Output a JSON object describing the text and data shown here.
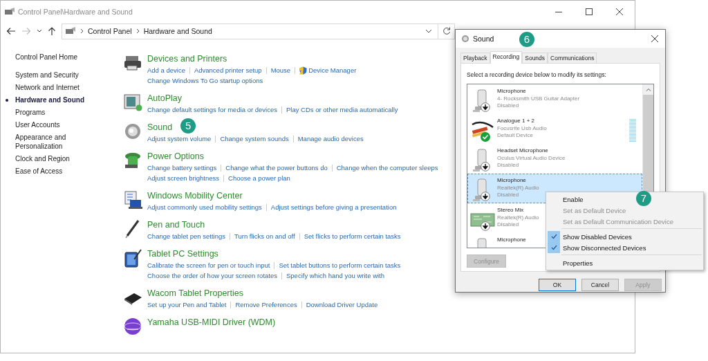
{
  "window": {
    "title": "Control Panel\\Hardware and Sound"
  },
  "address": {
    "crumbs": [
      "Control Panel",
      "Hardware and Sound"
    ]
  },
  "sidebar": {
    "home": "Control Panel Home",
    "items": [
      {
        "label": "System and Security",
        "selected": false
      },
      {
        "label": "Network and Internet",
        "selected": false
      },
      {
        "label": "Hardware and Sound",
        "selected": true
      },
      {
        "label": "Programs",
        "selected": false
      },
      {
        "label": "User Accounts",
        "selected": false
      },
      {
        "label": "Appearance and Personalization",
        "selected": false
      },
      {
        "label": "Clock and Region",
        "selected": false
      },
      {
        "label": "Ease of Access",
        "selected": false
      }
    ]
  },
  "categories": [
    {
      "kind": "printer",
      "title": "Devices and Printers",
      "lines": [
        [
          {
            "text": "Add a device",
            "shield": false
          },
          {
            "text": "Advanced printer setup",
            "shield": false
          },
          {
            "text": "Mouse",
            "shield": false
          },
          {
            "text": "Device Manager",
            "shield": true
          }
        ],
        [
          {
            "text": "Change Windows To Go startup options",
            "shield": false
          }
        ]
      ]
    },
    {
      "kind": "autoplay",
      "title": "AutoPlay",
      "lines": [
        [
          {
            "text": "Change default settings for media or devices",
            "shield": false
          },
          {
            "text": "Play CDs or other media automatically",
            "shield": false
          }
        ]
      ]
    },
    {
      "kind": "sound",
      "title": "Sound",
      "callout": "5",
      "lines": [
        [
          {
            "text": "Adjust system volume",
            "shield": false
          },
          {
            "text": "Change system sounds",
            "shield": false
          },
          {
            "text": "Manage audio devices",
            "shield": false
          }
        ]
      ]
    },
    {
      "kind": "power",
      "title": "Power Options",
      "lines": [
        [
          {
            "text": "Change battery settings",
            "shield": false
          },
          {
            "text": "Change what the power buttons do",
            "shield": false
          },
          {
            "text": "Change when the computer sleeps",
            "shield": false
          }
        ],
        [
          {
            "text": "Adjust screen brightness",
            "shield": false
          },
          {
            "text": "Choose a power plan",
            "shield": false
          }
        ]
      ]
    },
    {
      "kind": "mobility",
      "title": "Windows Mobility Center",
      "lines": [
        [
          {
            "text": "Adjust commonly used mobility settings",
            "shield": false
          },
          {
            "text": "Adjust settings before giving a presentation",
            "shield": false
          }
        ]
      ]
    },
    {
      "kind": "pen",
      "title": "Pen and Touch",
      "lines": [
        [
          {
            "text": "Change tablet pen settings",
            "shield": false
          },
          {
            "text": "Turn flicks on and off",
            "shield": false
          },
          {
            "text": "Set flicks to perform certain tasks",
            "shield": false
          }
        ]
      ]
    },
    {
      "kind": "tablet",
      "title": "Tablet PC Settings",
      "lines": [
        [
          {
            "text": "Calibrate the screen for pen or touch input",
            "shield": false
          },
          {
            "text": "Set tablet buttons to perform certain tasks",
            "shield": false
          }
        ],
        [
          {
            "text": "Choose the order of how your screen rotates",
            "shield": false
          },
          {
            "text": "Specify which hand you write with",
            "shield": false
          }
        ]
      ]
    },
    {
      "kind": "wacom",
      "title": "Wacom Tablet Properties",
      "lines": [
        [
          {
            "text": "Set up your Pen and Tablet",
            "shield": false
          },
          {
            "text": "Remove Preferences",
            "shield": false
          },
          {
            "text": "Download Driver Update",
            "shield": false
          }
        ]
      ]
    },
    {
      "kind": "midi",
      "title": "Yamaha USB-MIDI Driver (WDM)"
    }
  ],
  "dialog": {
    "title": "Sound",
    "callout": "6",
    "tabs": [
      {
        "label": "Playback",
        "selected": false
      },
      {
        "label": "Recording",
        "selected": true
      },
      {
        "label": "Sounds",
        "selected": false
      },
      {
        "label": "Communications",
        "selected": false
      }
    ],
    "instruction": "Select a recording device below to modify its settings:",
    "devices": [
      {
        "kind": "mic",
        "name": "Microphone",
        "lines": [
          "4- Rocksmith USB Guitar Adapter",
          "Disabled"
        ],
        "disabled": true,
        "default": false,
        "selected": false,
        "meter": false
      },
      {
        "kind": "cable",
        "name": "Analogue 1 + 2",
        "lines": [
          "Focusrite Usb Audio",
          "Default Device"
        ],
        "disabled": false,
        "default": true,
        "selected": false,
        "meter": true
      },
      {
        "kind": "mic",
        "name": "Headset Microphone",
        "lines": [
          "Oculus Virtual Audio Device",
          "Disabled"
        ],
        "disabled": true,
        "default": false,
        "selected": false,
        "meter": false
      },
      {
        "kind": "mic",
        "name": "Microphone",
        "lines": [
          "Realtek(R) Audio",
          "Disabled"
        ],
        "disabled": true,
        "default": false,
        "selected": true,
        "meter": false
      },
      {
        "kind": "board",
        "name": "Stereo Mix",
        "lines": [
          "Realtek(R) Audio",
          "Disabled"
        ],
        "disabled": true,
        "default": false,
        "selected": false,
        "meter": false
      },
      {
        "kind": "mic",
        "name": "Microphone",
        "disabled": false,
        "default": false,
        "selected": false,
        "meter": false
      }
    ],
    "configure": {
      "label": "Configure",
      "disabled": true
    },
    "buttons": [
      {
        "label": "OK",
        "disabled": false,
        "default": true
      },
      {
        "label": "Cancel",
        "disabled": false,
        "default": false
      },
      {
        "label": "Apply",
        "disabled": true,
        "default": false
      }
    ]
  },
  "context_menu": {
    "groups": [
      [
        {
          "label": "Enable",
          "disabled": false,
          "checked": false,
          "callout": "7"
        },
        {
          "label": "Set as Default Device",
          "disabled": true,
          "checked": false
        },
        {
          "label": "Set as Default Communication Device",
          "disabled": true,
          "checked": false
        }
      ],
      [
        {
          "label": "Show Disabled Devices",
          "disabled": false,
          "checked": true
        },
        {
          "label": "Show Disconnected Devices",
          "disabled": false,
          "checked": true
        }
      ],
      [
        {
          "label": "Properties",
          "disabled": false,
          "checked": false
        }
      ]
    ]
  }
}
